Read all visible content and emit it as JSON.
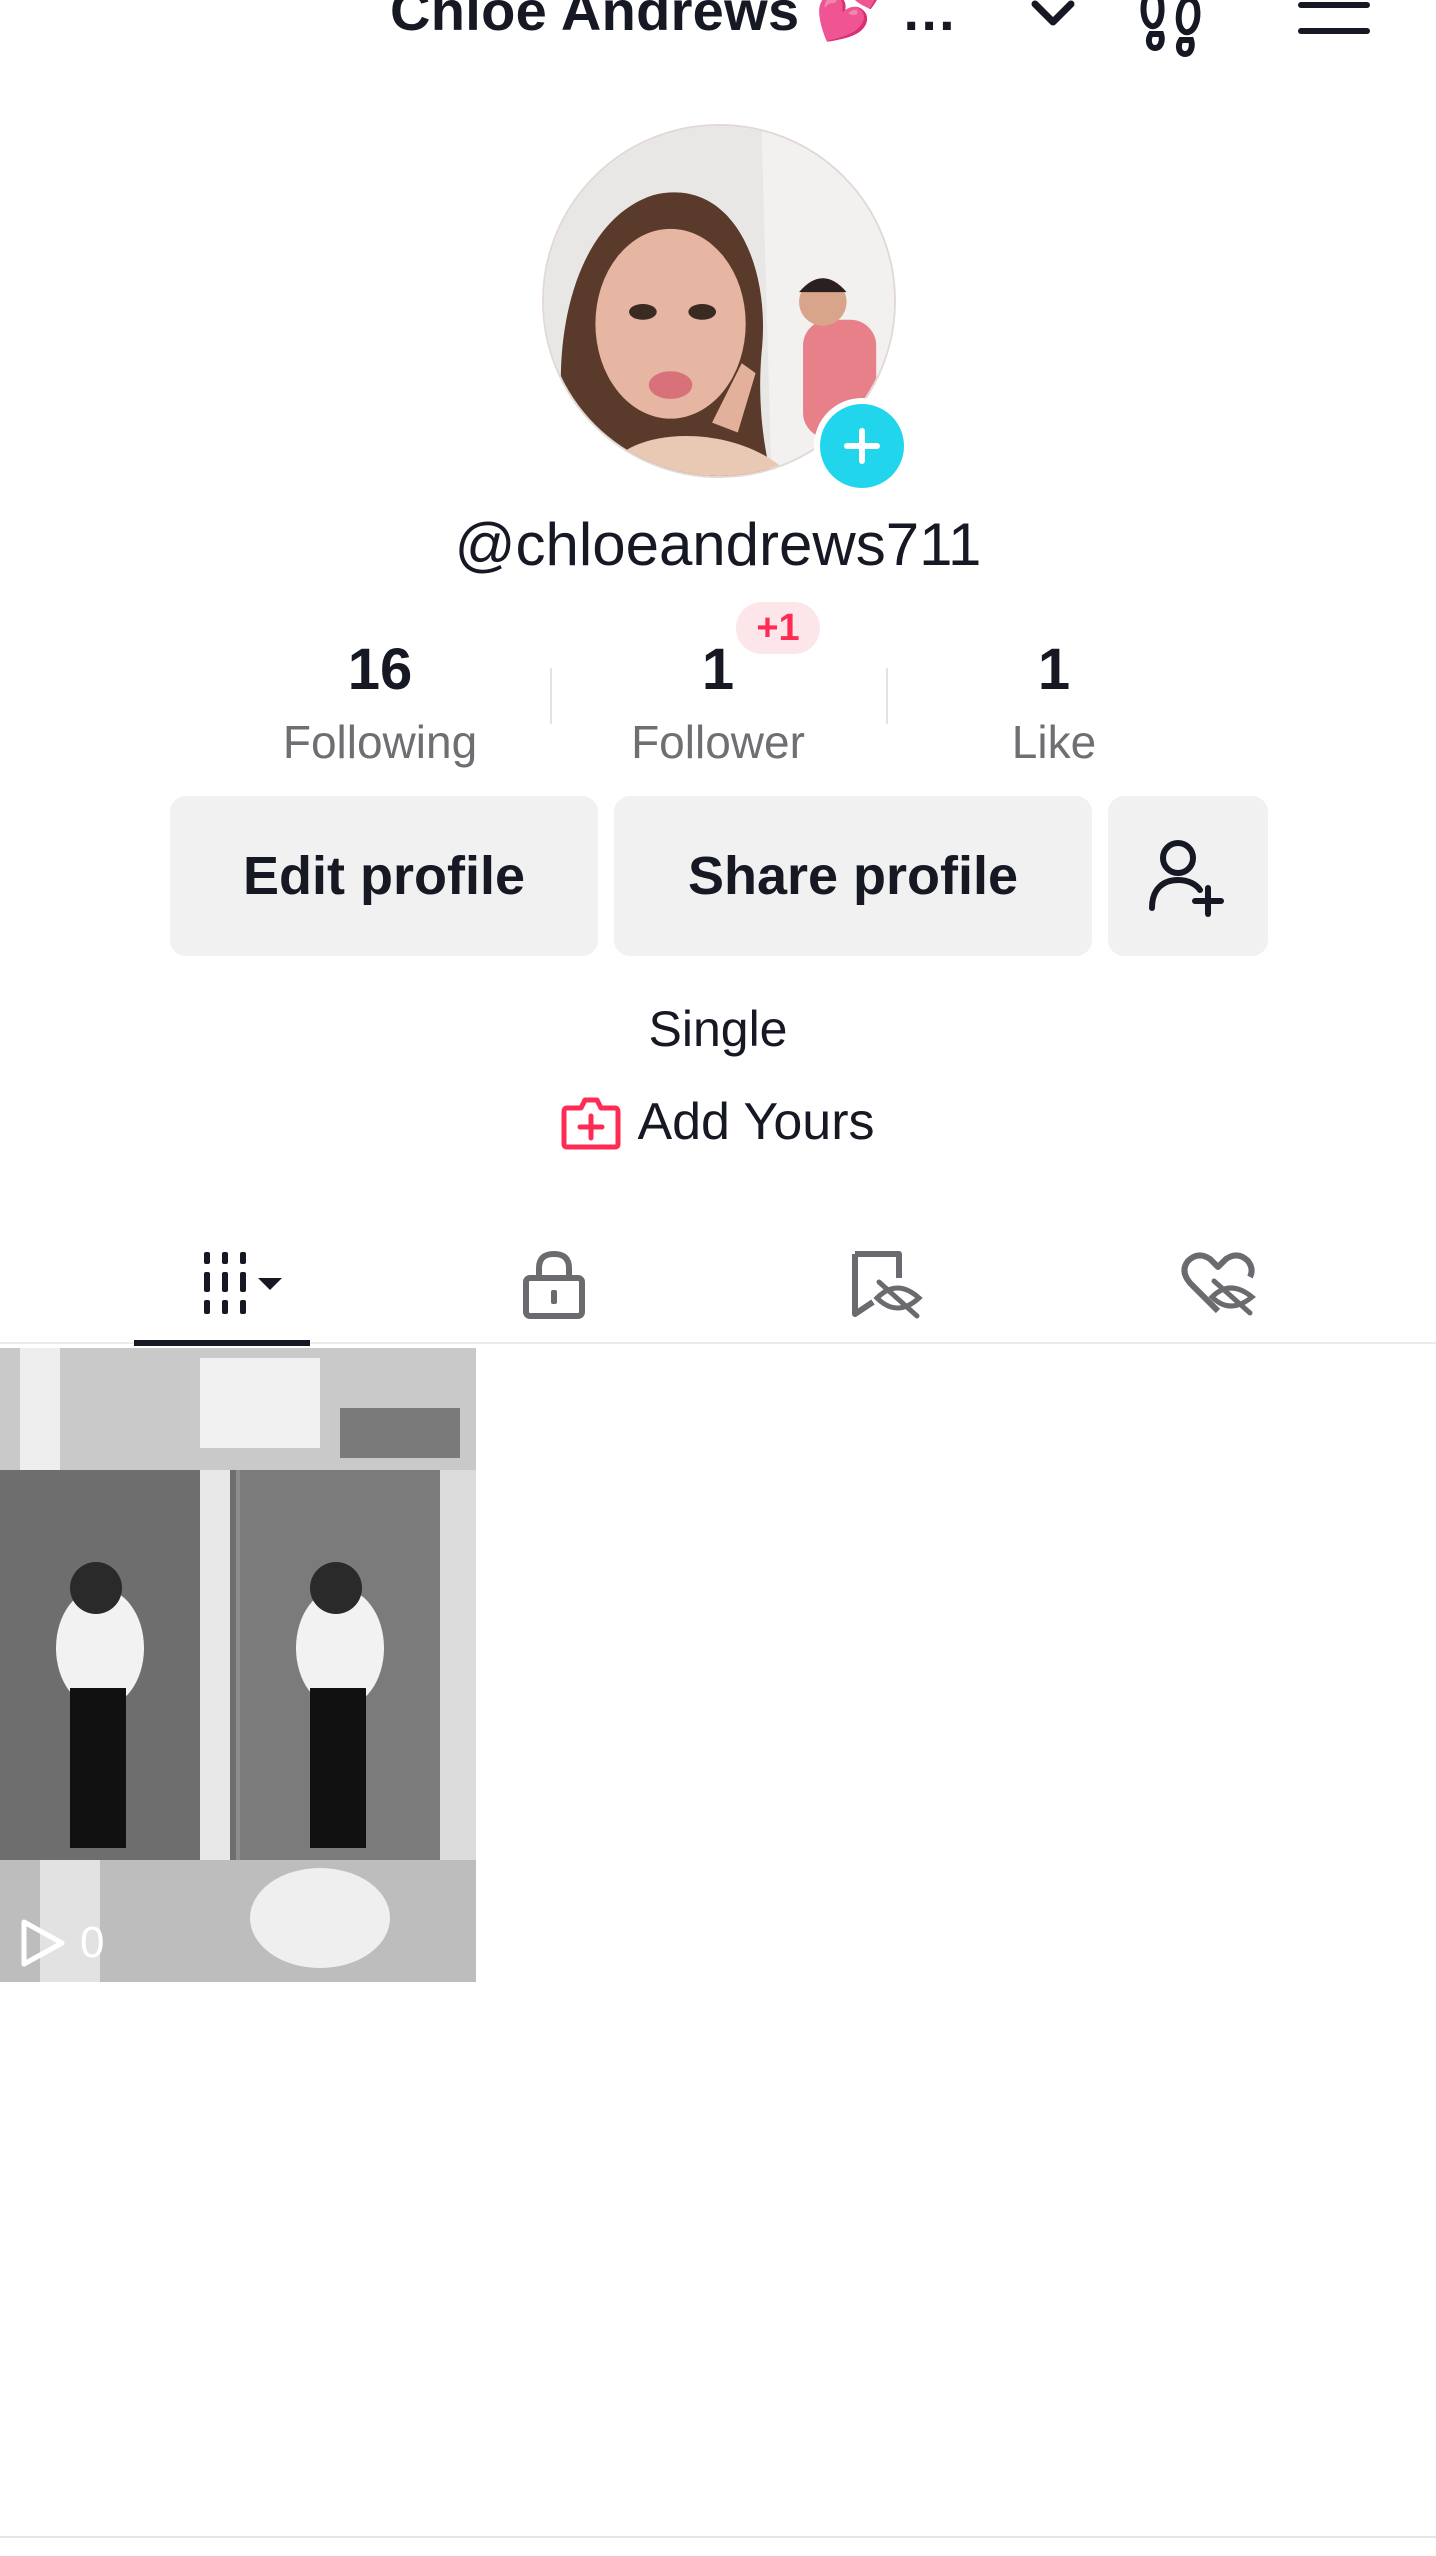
{
  "header": {
    "title": "Chloe Andrews 💕 …"
  },
  "profile": {
    "username": "@chloeandrews711",
    "bio": "Single",
    "add_yours_label": "Add Yours"
  },
  "stats": {
    "following": {
      "count": "16",
      "label": "Following"
    },
    "followers": {
      "count": "1",
      "label": "Follower",
      "badge": "+1"
    },
    "likes": {
      "count": "1",
      "label": "Like"
    }
  },
  "actions": {
    "edit_label": "Edit profile",
    "share_label": "Share profile"
  },
  "tabs": [
    {
      "icon": "grid-icon",
      "active": true
    },
    {
      "icon": "lock-icon"
    },
    {
      "icon": "repost-hidden-icon"
    },
    {
      "icon": "liked-hidden-icon"
    }
  ],
  "videos": [
    {
      "views": "0"
    }
  ],
  "colors": {
    "accent_cyan": "#20d5ec",
    "accent_red": "#fe2c55",
    "button_bg": "#f1f1f2",
    "text_primary": "#161823",
    "text_secondary": "#6f6f73"
  }
}
